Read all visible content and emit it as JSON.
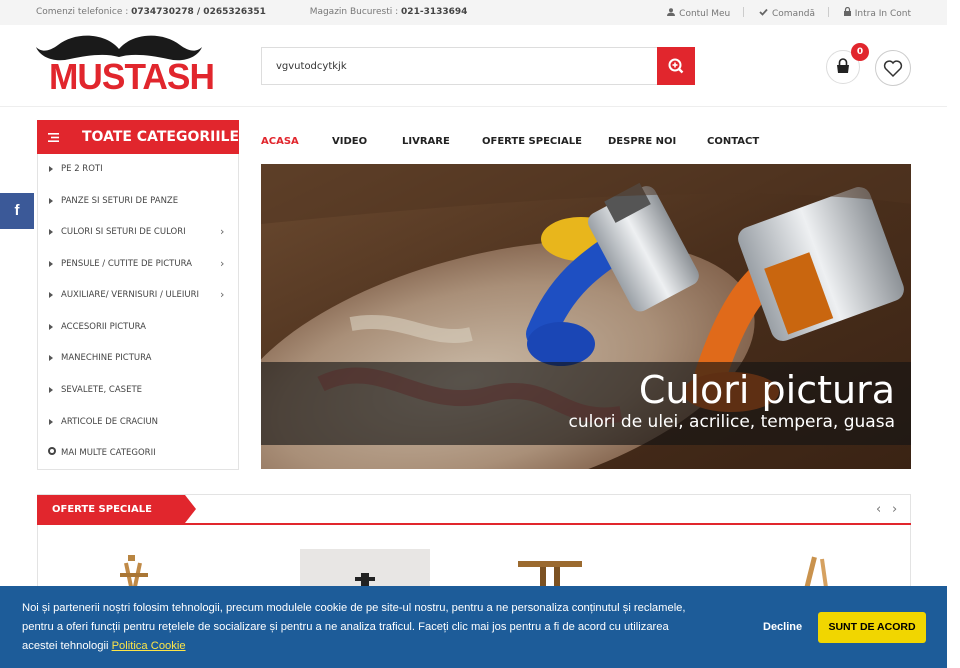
{
  "topbar": {
    "phone_label": "Comenzi telefonice :",
    "phone_numbers": "0734730278 / 0265326351",
    "store_label": "Magazin Bucuresti :",
    "store_phone": "021-3133694",
    "account_link": "Contul Meu",
    "order_link": "Comandă",
    "login_link": "Intra In Cont"
  },
  "header": {
    "logo_text": "MUSTASH",
    "search_value": "vgvutodcytkjk",
    "cart_count": "0"
  },
  "categories": {
    "title": "TOATE CATEGORIILE",
    "items": [
      {
        "label": "PE 2 ROTI",
        "has_sub": false
      },
      {
        "label": "PANZE SI SETURI DE PANZE",
        "has_sub": false
      },
      {
        "label": "CULORI SI SETURI DE CULORI",
        "has_sub": true
      },
      {
        "label": "PENSULE / CUTITE DE PICTURA",
        "has_sub": true
      },
      {
        "label": "AUXILIARE/ VERNISURI / ULEIURI",
        "has_sub": true
      },
      {
        "label": "ACCESORII PICTURA",
        "has_sub": false
      },
      {
        "label": "MANECHINE PICTURA",
        "has_sub": false
      },
      {
        "label": "SEVALETE, CASETE",
        "has_sub": false
      },
      {
        "label": "ARTICOLE DE CRACIUN",
        "has_sub": false
      }
    ],
    "more": "MAI MULTE CATEGORII"
  },
  "menu": {
    "items": [
      "ACASA",
      "VIDEO",
      "LIVRARE",
      "OFERTE SPECIALE",
      "DESPRE NOI",
      "CONTACT"
    ],
    "active": "ACASA"
  },
  "banner": {
    "title": "Culori pictura",
    "subtitle": "culori de ulei, acrilice, tempera, guasa"
  },
  "offers": {
    "title": "OFERTE SPECIALE",
    "prev": "‹",
    "next": "›"
  },
  "cookie": {
    "line1": "Noi și partenerii noștri folosim tehnologii, precum modulele cookie de pe site-ul nostru, pentru a ne personaliza conținutul și reclamele,",
    "line2": "pentru a oferi funcții pentru rețelele de socializare și pentru a ne analiza traficul. Faceți clic mai jos pentru a fi de acord cu utilizarea",
    "line3": "acestei tehnologii",
    "policy_link": "Politica Cookie",
    "decline": "Decline",
    "accept": "SUNT DE ACORD"
  },
  "social": {
    "facebook": "f"
  },
  "colors": {
    "brand": "#e1262d",
    "cookie_bg": "#1d5c99",
    "accept_btn": "#f1d600"
  },
  "icons": [
    "user-icon",
    "check-icon",
    "lock-icon",
    "search-plus-icon",
    "cart-icon",
    "heart-icon",
    "menu-icon",
    "facebook-icon"
  ]
}
